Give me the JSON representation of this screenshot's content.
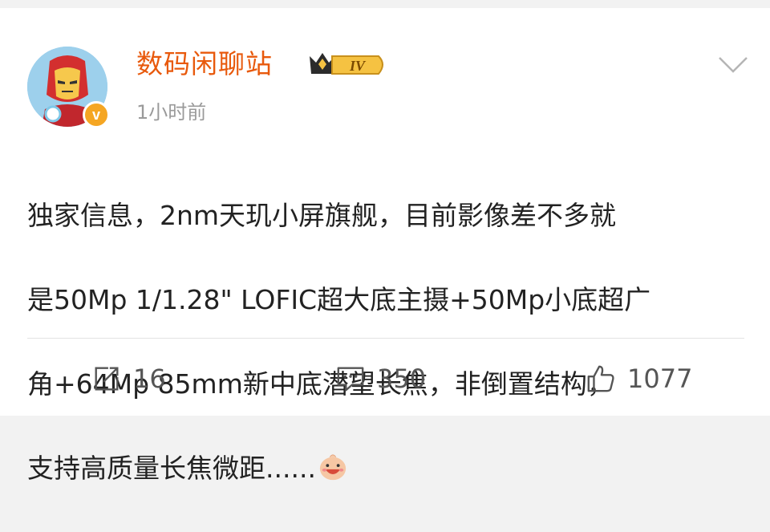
{
  "post": {
    "username": "数码闲聊站",
    "level_badge": "IV",
    "verified_badge": "v",
    "time": "1小时前",
    "content_lines": [
      "独家信息，2nm天玑小屏旗舰，目前影像差不多就",
      "是50Mp 1/1.28\" LOFIC超大底主摄+50Mp小底超广",
      "角+64Mp 85mm新中底潜望长焦，非倒置结构，",
      "支持高质量长焦微距......"
    ],
    "emoji_icon": "grinning-face-emoji",
    "more_icon": "chevron-down-icon"
  },
  "actions": {
    "share": {
      "icon": "share-icon",
      "count": "16"
    },
    "comment": {
      "icon": "comment-icon",
      "count": "350"
    },
    "like": {
      "icon": "thumbs-up-icon",
      "count": "1077"
    }
  },
  "colors": {
    "username": "#e8590c",
    "verified": "#f5a623",
    "time": "#9a9a9a",
    "text": "#222222"
  }
}
